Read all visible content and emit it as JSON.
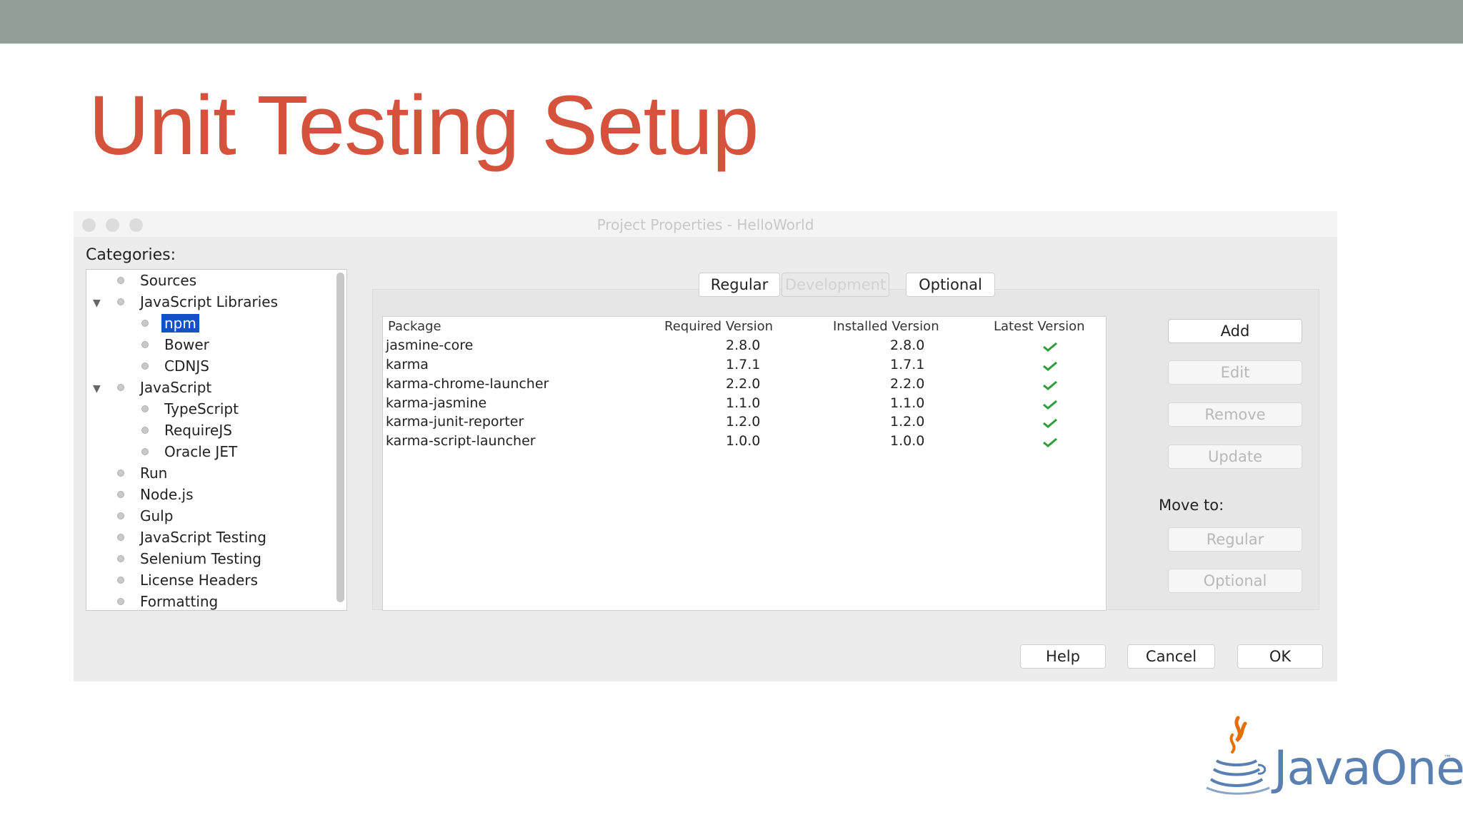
{
  "slide": {
    "title": "Unit Testing Setup"
  },
  "dialog": {
    "title": "Project Properties - HelloWorld",
    "categories_label": "Categories:",
    "tree": [
      {
        "label": "Sources"
      },
      {
        "label": "JavaScript Libraries"
      },
      {
        "label": "npm"
      },
      {
        "label": "Bower"
      },
      {
        "label": "CDNJS"
      },
      {
        "label": "JavaScript"
      },
      {
        "label": "TypeScript"
      },
      {
        "label": "RequireJS"
      },
      {
        "label": "Oracle JET"
      },
      {
        "label": "Run"
      },
      {
        "label": "Node.js"
      },
      {
        "label": "Gulp"
      },
      {
        "label": "JavaScript Testing"
      },
      {
        "label": "Selenium Testing"
      },
      {
        "label": "License Headers"
      },
      {
        "label": "Formatting"
      }
    ],
    "tabs": {
      "regular": "Regular",
      "development": "Development",
      "optional": "Optional"
    },
    "table": {
      "headers": {
        "package": "Package",
        "required": "Required Version",
        "installed": "Installed Version",
        "latest": "Latest Version"
      },
      "rows": [
        {
          "package": "jasmine-core",
          "required": "2.8.0",
          "installed": "2.8.0"
        },
        {
          "package": "karma",
          "required": "1.7.1",
          "installed": "1.7.1"
        },
        {
          "package": "karma-chrome-launcher",
          "required": "2.2.0",
          "installed": "2.2.0"
        },
        {
          "package": "karma-jasmine",
          "required": "1.1.0",
          "installed": "1.1.0"
        },
        {
          "package": "karma-junit-reporter",
          "required": "1.2.0",
          "installed": "1.2.0"
        },
        {
          "package": "karma-script-launcher",
          "required": "1.0.0",
          "installed": "1.0.0"
        }
      ],
      "latest_icon": "checkmark-icon",
      "check_color": "#2e9e3a"
    },
    "buttons": {
      "add": "Add",
      "edit": "Edit",
      "remove": "Remove",
      "update": "Update",
      "move_to": "Move to:",
      "move_regular": "Regular",
      "move_optional": "Optional",
      "help": "Help",
      "cancel": "Cancel",
      "ok": "OK"
    }
  },
  "logo": {
    "text": "JavaOne",
    "tm": "™"
  },
  "colors": {
    "title": "#d5533c",
    "band": "#929f96",
    "selection": "#1450c8",
    "logo": "#5a7fb1"
  }
}
